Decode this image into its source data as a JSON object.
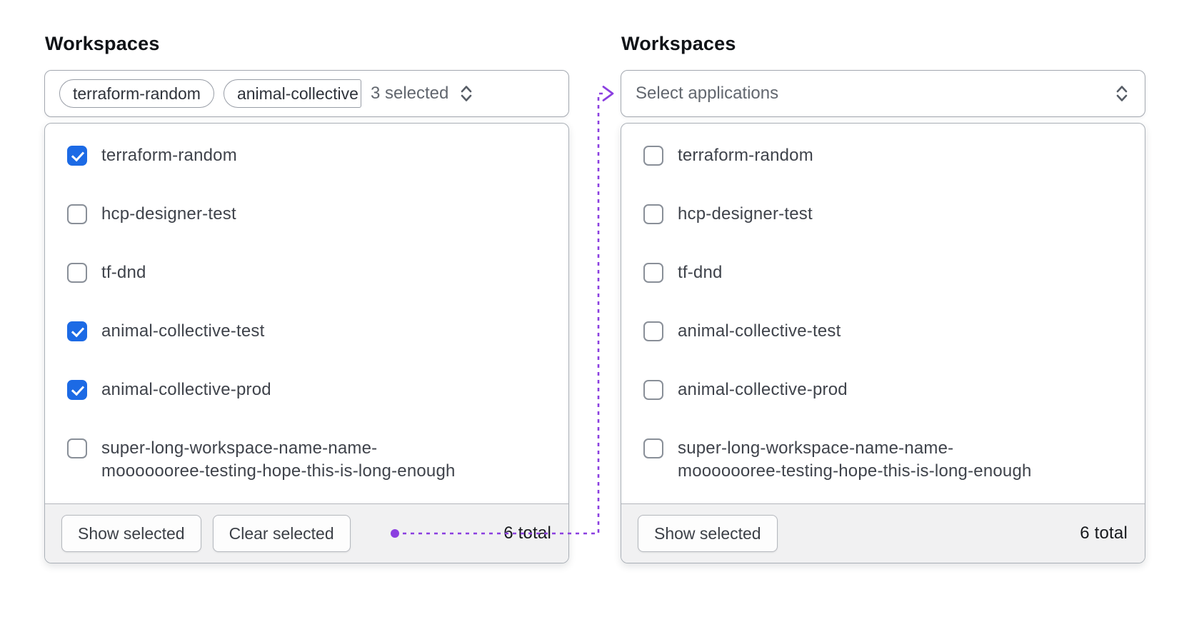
{
  "colors": {
    "checkbox_checked_blue": "#1c6ae5",
    "connector_purple": "#8b3fe0",
    "panel_border_gray": "#aab0b7",
    "footer_background": "#f1f1f2"
  },
  "panels": [
    {
      "title": "Workspaces",
      "trigger": {
        "tags": [
          "terraform-random",
          "animal-collective"
        ],
        "count_label": "3 selected",
        "chevron_icon": "chevron-up-down"
      },
      "items": [
        {
          "label": "terraform-random",
          "checked": true
        },
        {
          "label": "hcp-designer-test",
          "checked": false
        },
        {
          "label": "tf-dnd",
          "checked": false
        },
        {
          "label": "animal-collective-test",
          "checked": true
        },
        {
          "label": "animal-collective-prod",
          "checked": true
        },
        {
          "label": "super-long-workspace-name-name-\nmooooooree-testing-hope-this-is-long-enough",
          "checked": false
        }
      ],
      "footer": {
        "show_label": "Show selected",
        "clear_label": "Clear selected",
        "total_label": "6 total"
      }
    },
    {
      "title": "Workspaces",
      "trigger": {
        "placeholder": "Select applications",
        "chevron_icon": "chevron-up-down"
      },
      "items": [
        {
          "label": "terraform-random",
          "checked": false
        },
        {
          "label": "hcp-designer-test",
          "checked": false
        },
        {
          "label": "tf-dnd",
          "checked": false
        },
        {
          "label": "animal-collective-test",
          "checked": false
        },
        {
          "label": "animal-collective-prod",
          "checked": false
        },
        {
          "label": "super-long-workspace-name-name-\nmooooooree-testing-hope-this-is-long-enough",
          "checked": false
        }
      ],
      "footer": {
        "show_label": "Show selected",
        "total_label": "6 total"
      }
    }
  ]
}
